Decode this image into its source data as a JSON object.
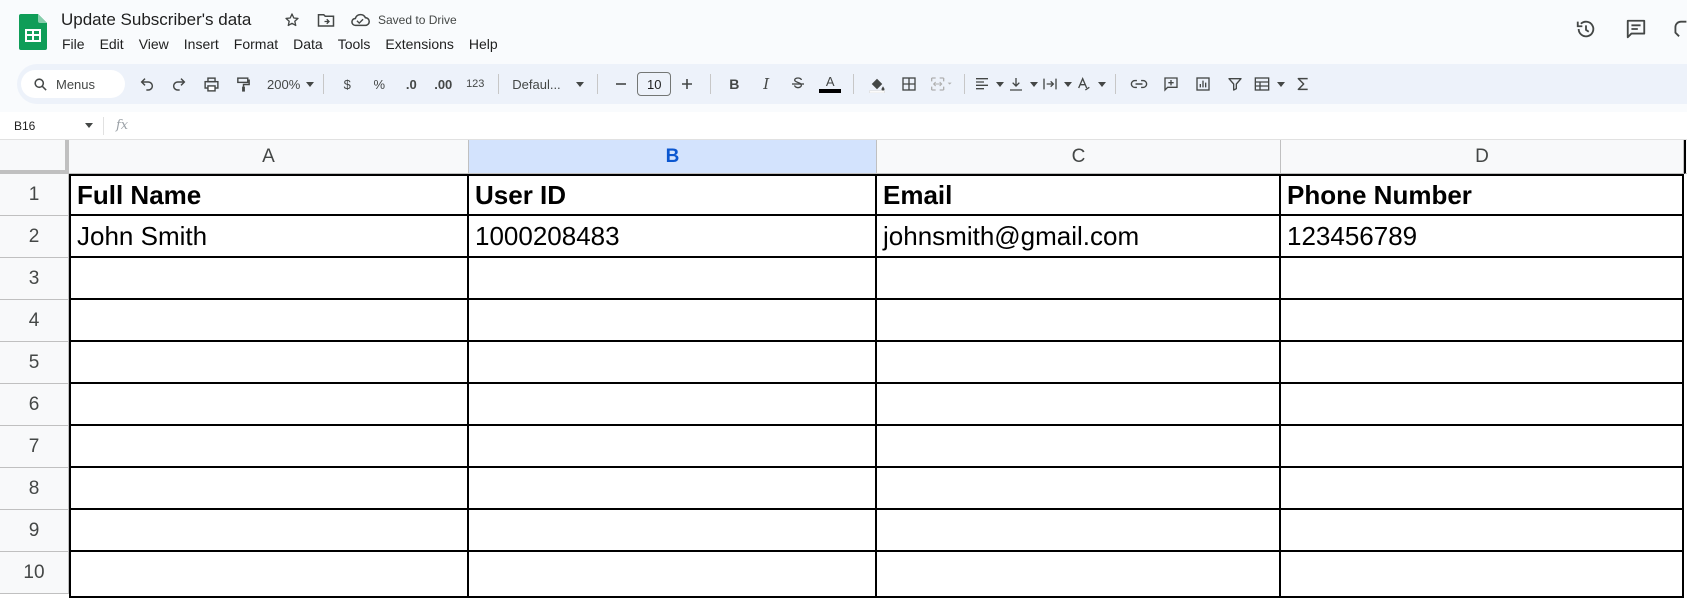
{
  "app": {
    "doc_title": "Update Subscriber's data",
    "saved_status": "Saved to Drive"
  },
  "menu": [
    "File",
    "Edit",
    "View",
    "Insert",
    "Format",
    "Data",
    "Tools",
    "Extensions",
    "Help"
  ],
  "toolbar": {
    "search_label": "Menus",
    "zoom": "200%",
    "currency": "$",
    "percent": "%",
    "decrease_decimal": ".0",
    "increase_decimal": ".00",
    "number_format": "123",
    "font_name": "Defaul...",
    "font_size": "10",
    "bold": "B",
    "italic": "I",
    "text_color": "A"
  },
  "formula_bar": {
    "cell_ref": "B16",
    "fx": "fx"
  },
  "sheet": {
    "columns": [
      "A",
      "B",
      "C",
      "D"
    ],
    "selected_column": "B",
    "rows": [
      "1",
      "2",
      "3",
      "4",
      "5",
      "6",
      "7",
      "8",
      "9",
      "10"
    ],
    "cells": {
      "r1": [
        "Full Name",
        "User ID",
        "Email",
        "Phone Number"
      ],
      "r2": [
        "John Smith",
        "1000208483",
        "johnsmith@gmail.com",
        "123456789"
      ]
    }
  },
  "colors": {
    "sheets_green": "#0f9d58",
    "selected_header_bg": "#d3e3fd",
    "selected_header_text": "#0b57d0",
    "toolbar_bg": "#edf2fa"
  }
}
